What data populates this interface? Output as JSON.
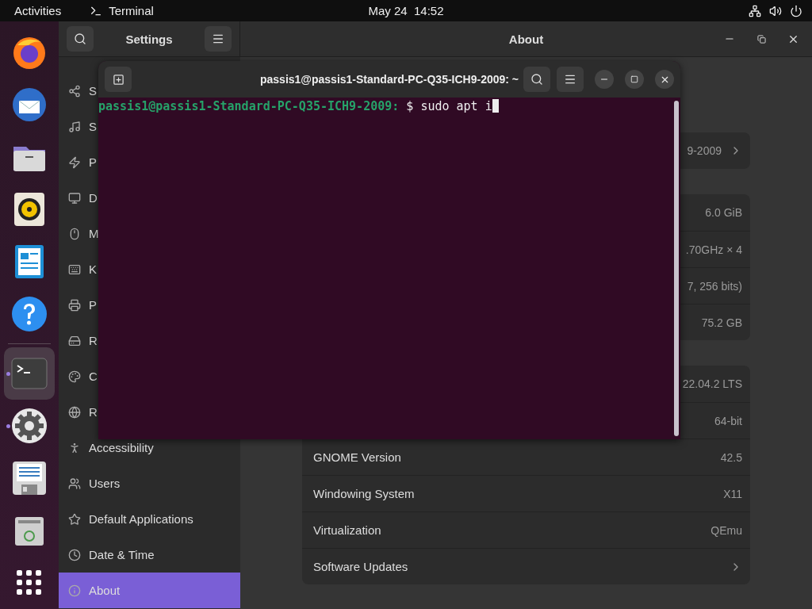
{
  "top_bar": {
    "activities": "Activities",
    "app_name": "Terminal",
    "clock": "May 24  14:52"
  },
  "dock": [
    {
      "kind": "firefox",
      "running": false,
      "selected": false
    },
    {
      "kind": "mail",
      "running": false,
      "selected": false
    },
    {
      "kind": "files",
      "running": false,
      "selected": false
    },
    {
      "kind": "speaker",
      "running": false,
      "selected": false
    },
    {
      "kind": "writer",
      "running": false,
      "selected": false
    },
    {
      "kind": "help",
      "running": false,
      "selected": false
    },
    {
      "kind": "terminal",
      "running": true,
      "selected": true
    },
    {
      "kind": "settings",
      "running": true,
      "selected": false
    },
    {
      "kind": "floppy",
      "running": false,
      "selected": false
    },
    {
      "kind": "trash",
      "running": false,
      "selected": false
    },
    {
      "kind": "grid",
      "running": false,
      "selected": false
    }
  ],
  "settings": {
    "sidebar_title": "Settings",
    "page_title": "About",
    "sidebar_items": [
      {
        "label": "S",
        "selected": false
      },
      {
        "label": "S",
        "selected": false
      },
      {
        "label": "P",
        "selected": false
      },
      {
        "label": "D",
        "selected": false
      },
      {
        "label": "M",
        "selected": false
      },
      {
        "label": "K",
        "selected": false
      },
      {
        "label": "P",
        "selected": false
      },
      {
        "label": "R",
        "selected": false
      },
      {
        "label": "C",
        "selected": false
      },
      {
        "label": "R",
        "selected": false
      },
      {
        "label": "Accessibility",
        "selected": false
      },
      {
        "label": "Users",
        "selected": false
      },
      {
        "label": "Default Applications",
        "selected": false
      },
      {
        "label": "Date & Time",
        "selected": false
      },
      {
        "label": "About",
        "selected": true
      }
    ],
    "cards": [
      {
        "rows": [
          {
            "kind": "link",
            "value": "9-2009"
          }
        ]
      },
      {
        "rows": [
          {
            "kind": "info",
            "value": "6.0 GiB"
          },
          {
            "kind": "info",
            "value": ".70GHz × 4"
          },
          {
            "kind": "info",
            "value": "7, 256 bits)"
          },
          {
            "kind": "info",
            "value": "75.2 GB"
          }
        ]
      },
      {
        "rows": [
          {
            "kind": "info",
            "value": "22.04.2 LTS"
          },
          {
            "kind": "info",
            "value": "64-bit"
          },
          {
            "kind": "info",
            "label": "GNOME Version",
            "value": "42.5"
          },
          {
            "kind": "info",
            "label": "Windowing System",
            "value": "X11"
          },
          {
            "kind": "info",
            "label": "Virtualization",
            "value": "QEmu"
          },
          {
            "kind": "link",
            "label": "Software Updates"
          }
        ]
      }
    ]
  },
  "terminal": {
    "title": "passis1@passis1-Standard-PC-Q35-ICH9-2009: ~",
    "prompt": "passis1@passis1-Standard-PC-Q35-ICH9-2009:",
    "command": " $ sudo apt i"
  }
}
